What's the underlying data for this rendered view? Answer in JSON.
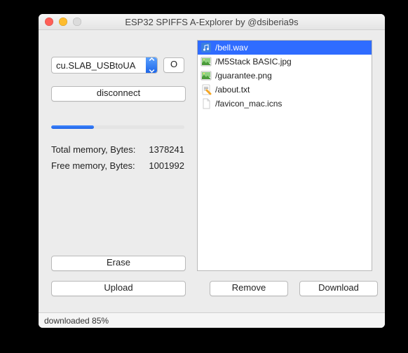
{
  "window": {
    "title": "ESP32 SPIFFS A-Explorer by @dsiberia9s"
  },
  "port": {
    "selected": "cu.SLAB_USBtoUA",
    "refresh_label": "O"
  },
  "actions": {
    "disconnect": "disconnect",
    "erase": "Erase",
    "upload": "Upload",
    "remove": "Remove",
    "download": "Download"
  },
  "progress": {
    "percent": 32
  },
  "stats": {
    "total_label": "Total memory, Bytes:",
    "total_value": "1378241",
    "free_label": "Free memory, Bytes:",
    "free_value": "1001992"
  },
  "files": [
    {
      "name": "/bell.wav",
      "icon": "audio",
      "selected": true
    },
    {
      "name": "/M5Stack BASIC.jpg",
      "icon": "image",
      "selected": false
    },
    {
      "name": "/guarantee.png",
      "icon": "image",
      "selected": false
    },
    {
      "name": "/about.txt",
      "icon": "text",
      "selected": false
    },
    {
      "name": "/favicon_mac.icns",
      "icon": "generic",
      "selected": false
    }
  ],
  "status": {
    "text": "downloaded 85%"
  }
}
